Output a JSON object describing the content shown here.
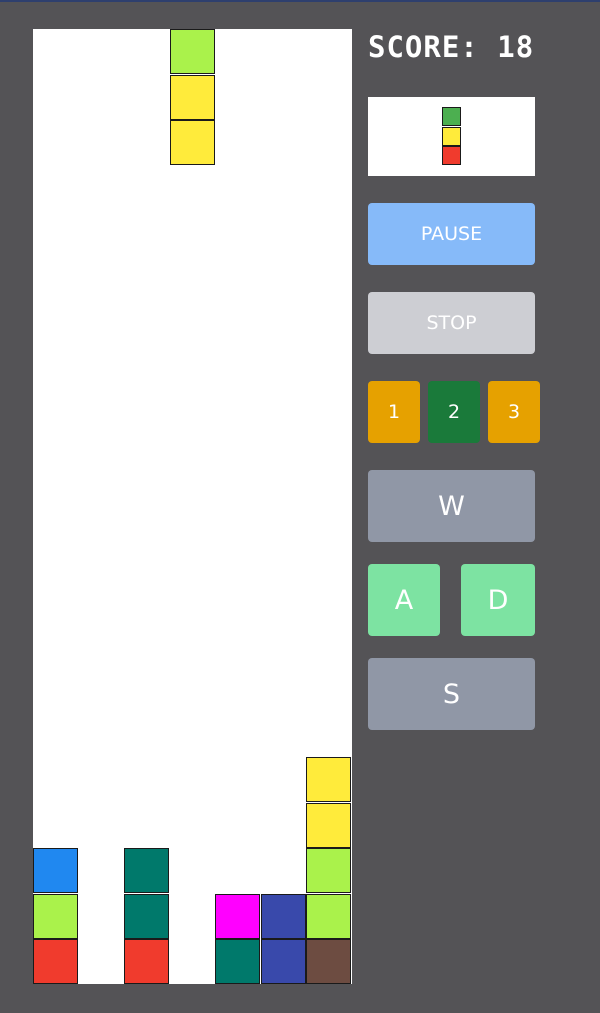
{
  "score": {
    "label": "SCORE:",
    "value": "18"
  },
  "preview": {
    "pieces": [
      "#4caf50",
      "#ffeb3b",
      "#f03b2d"
    ]
  },
  "controls": {
    "pause_label": "PAUSE",
    "stop_label": "STOP",
    "levels": [
      {
        "label": "1",
        "color": "#e6a100"
      },
      {
        "label": "2",
        "color": "#1a7a3a"
      },
      {
        "label": "3",
        "color": "#e6a100"
      }
    ],
    "up_label": "W",
    "left_label": "A",
    "right_label": "D",
    "down_label": "S"
  },
  "board": {
    "columns": 7,
    "rows": 21,
    "falling_piece": [
      {
        "col": 3,
        "row": 0,
        "color": "#aaf24b"
      },
      {
        "col": 3,
        "row": 1,
        "color": "#ffeb3b"
      },
      {
        "col": 3,
        "row": 2,
        "color": "#ffeb3b"
      }
    ],
    "settled_blocks": [
      {
        "col": 0,
        "row": 18,
        "color": "#2088f0"
      },
      {
        "col": 0,
        "row": 19,
        "color": "#aaf24b"
      },
      {
        "col": 0,
        "row": 20,
        "color": "#f03b2d"
      },
      {
        "col": 2,
        "row": 18,
        "color": "#00796b"
      },
      {
        "col": 2,
        "row": 19,
        "color": "#00796b"
      },
      {
        "col": 2,
        "row": 20,
        "color": "#f03b2d"
      },
      {
        "col": 4,
        "row": 19,
        "color": "#ff00ff"
      },
      {
        "col": 4,
        "row": 20,
        "color": "#00796b"
      },
      {
        "col": 5,
        "row": 19,
        "color": "#3949ab"
      },
      {
        "col": 5,
        "row": 20,
        "color": "#3949ab"
      },
      {
        "col": 6,
        "row": 16,
        "color": "#ffeb3b"
      },
      {
        "col": 6,
        "row": 17,
        "color": "#ffeb3b"
      },
      {
        "col": 6,
        "row": 18,
        "color": "#aaf24b"
      },
      {
        "col": 6,
        "row": 19,
        "color": "#aaf24b"
      },
      {
        "col": 6,
        "row": 20,
        "color": "#6d4c41"
      }
    ]
  }
}
